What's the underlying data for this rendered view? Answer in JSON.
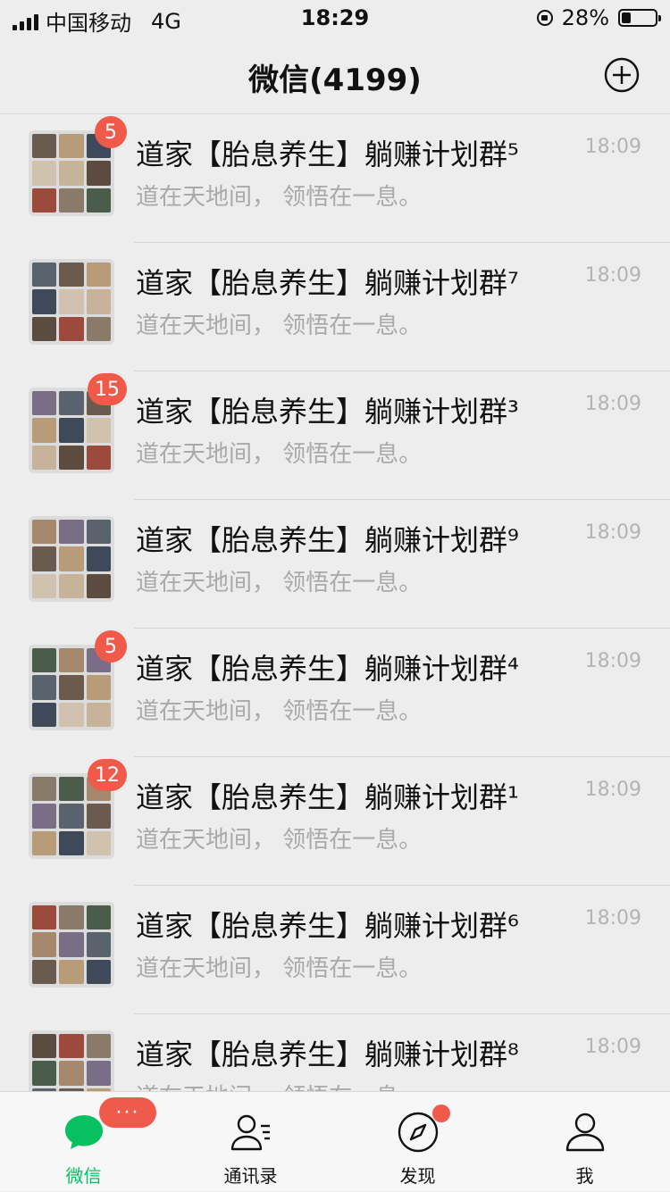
{
  "status_bar": {
    "carrier": "中国移动",
    "network": "4G",
    "time": "18:29",
    "battery": "28%",
    "battery_level": 0.28
  },
  "header": {
    "title": "微信(4199)",
    "add_icon": "plus-circle-icon"
  },
  "chats": [
    {
      "name": "道家【胎息养生】躺赚计划群⁵",
      "preview": "道在天地间， 领悟在一息。",
      "time": "18:09",
      "badge": "5"
    },
    {
      "name": "道家【胎息养生】躺赚计划群⁷",
      "preview": "道在天地间， 领悟在一息。",
      "time": "18:09",
      "badge": ""
    },
    {
      "name": "道家【胎息养生】躺赚计划群³",
      "preview": "道在天地间， 领悟在一息。",
      "time": "18:09",
      "badge": "15"
    },
    {
      "name": "道家【胎息养生】躺赚计划群⁹",
      "preview": "道在天地间， 领悟在一息。",
      "time": "18:09",
      "badge": ""
    },
    {
      "name": "道家【胎息养生】躺赚计划群⁴",
      "preview": "道在天地间， 领悟在一息。",
      "time": "18:09",
      "badge": "5"
    },
    {
      "name": "道家【胎息养生】躺赚计划群¹",
      "preview": "道在天地间， 领悟在一息。",
      "time": "18:09",
      "badge": "12"
    },
    {
      "name": "道家【胎息养生】躺赚计划群⁶",
      "preview": "道在天地间， 领悟在一息。",
      "time": "18:09",
      "badge": ""
    },
    {
      "name": "道家【胎息养生】躺赚计划群⁸",
      "preview": "道在天地间， 领悟在一息。",
      "time": "18:09",
      "badge": ""
    }
  ],
  "tabbar": {
    "items": [
      {
        "label": "微信",
        "icon": "chat-bubble-icon",
        "badge": "···"
      },
      {
        "label": "通讯录",
        "icon": "contacts-icon"
      },
      {
        "label": "发现",
        "icon": "compass-icon"
      },
      {
        "label": "我",
        "icon": "person-icon"
      }
    ]
  },
  "colors": {
    "accent": "#07c160",
    "badge": "#f05a4a",
    "background": "#ededed"
  }
}
